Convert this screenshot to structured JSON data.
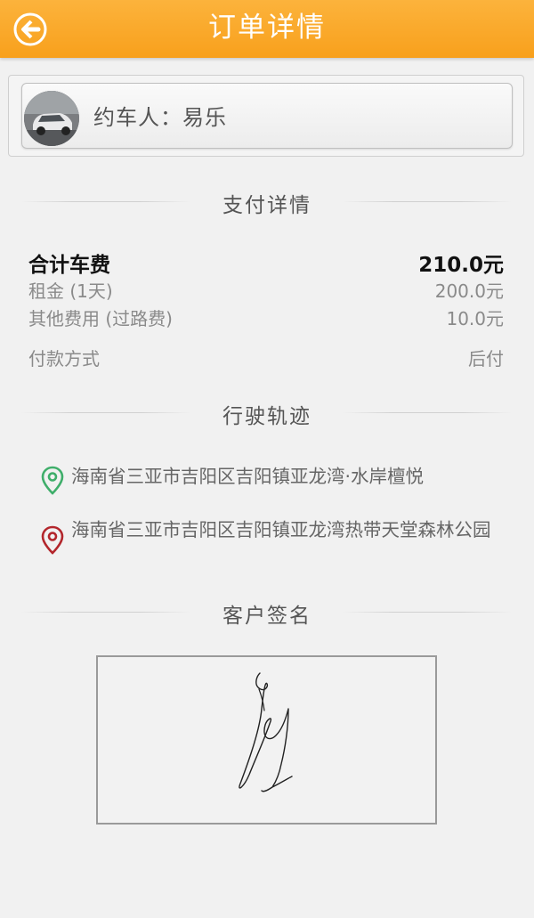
{
  "header": {
    "title": "订单详情",
    "back_icon": "back-arrow-icon"
  },
  "booker": {
    "label": "约车人：易乐",
    "avatar_icon": "car-avatar"
  },
  "payment": {
    "section_title": "支付详情",
    "total_label": "合计车费",
    "total_value": "210.0元",
    "items": [
      {
        "label": "租金 (1天)",
        "value": "200.0元"
      },
      {
        "label": "其他费用 (过路费)",
        "value": "10.0元"
      }
    ],
    "method_label": "付款方式",
    "method_value": "后付"
  },
  "trip": {
    "section_title": "行驶轨迹",
    "start": {
      "address": "海南省三亚市吉阳区吉阳镇亚龙湾·水岸檀悦",
      "icon": "start-location-pin-icon",
      "color": "#3fae6a"
    },
    "end": {
      "address": "海南省三亚市吉阳区吉阳镇亚龙湾热带天堂森林公园",
      "icon": "end-location-pin-icon",
      "color": "#b3262c"
    }
  },
  "signature": {
    "section_title": "客户签名"
  },
  "colors": {
    "header": "#f8a01c",
    "background": "#f1f1f1"
  }
}
